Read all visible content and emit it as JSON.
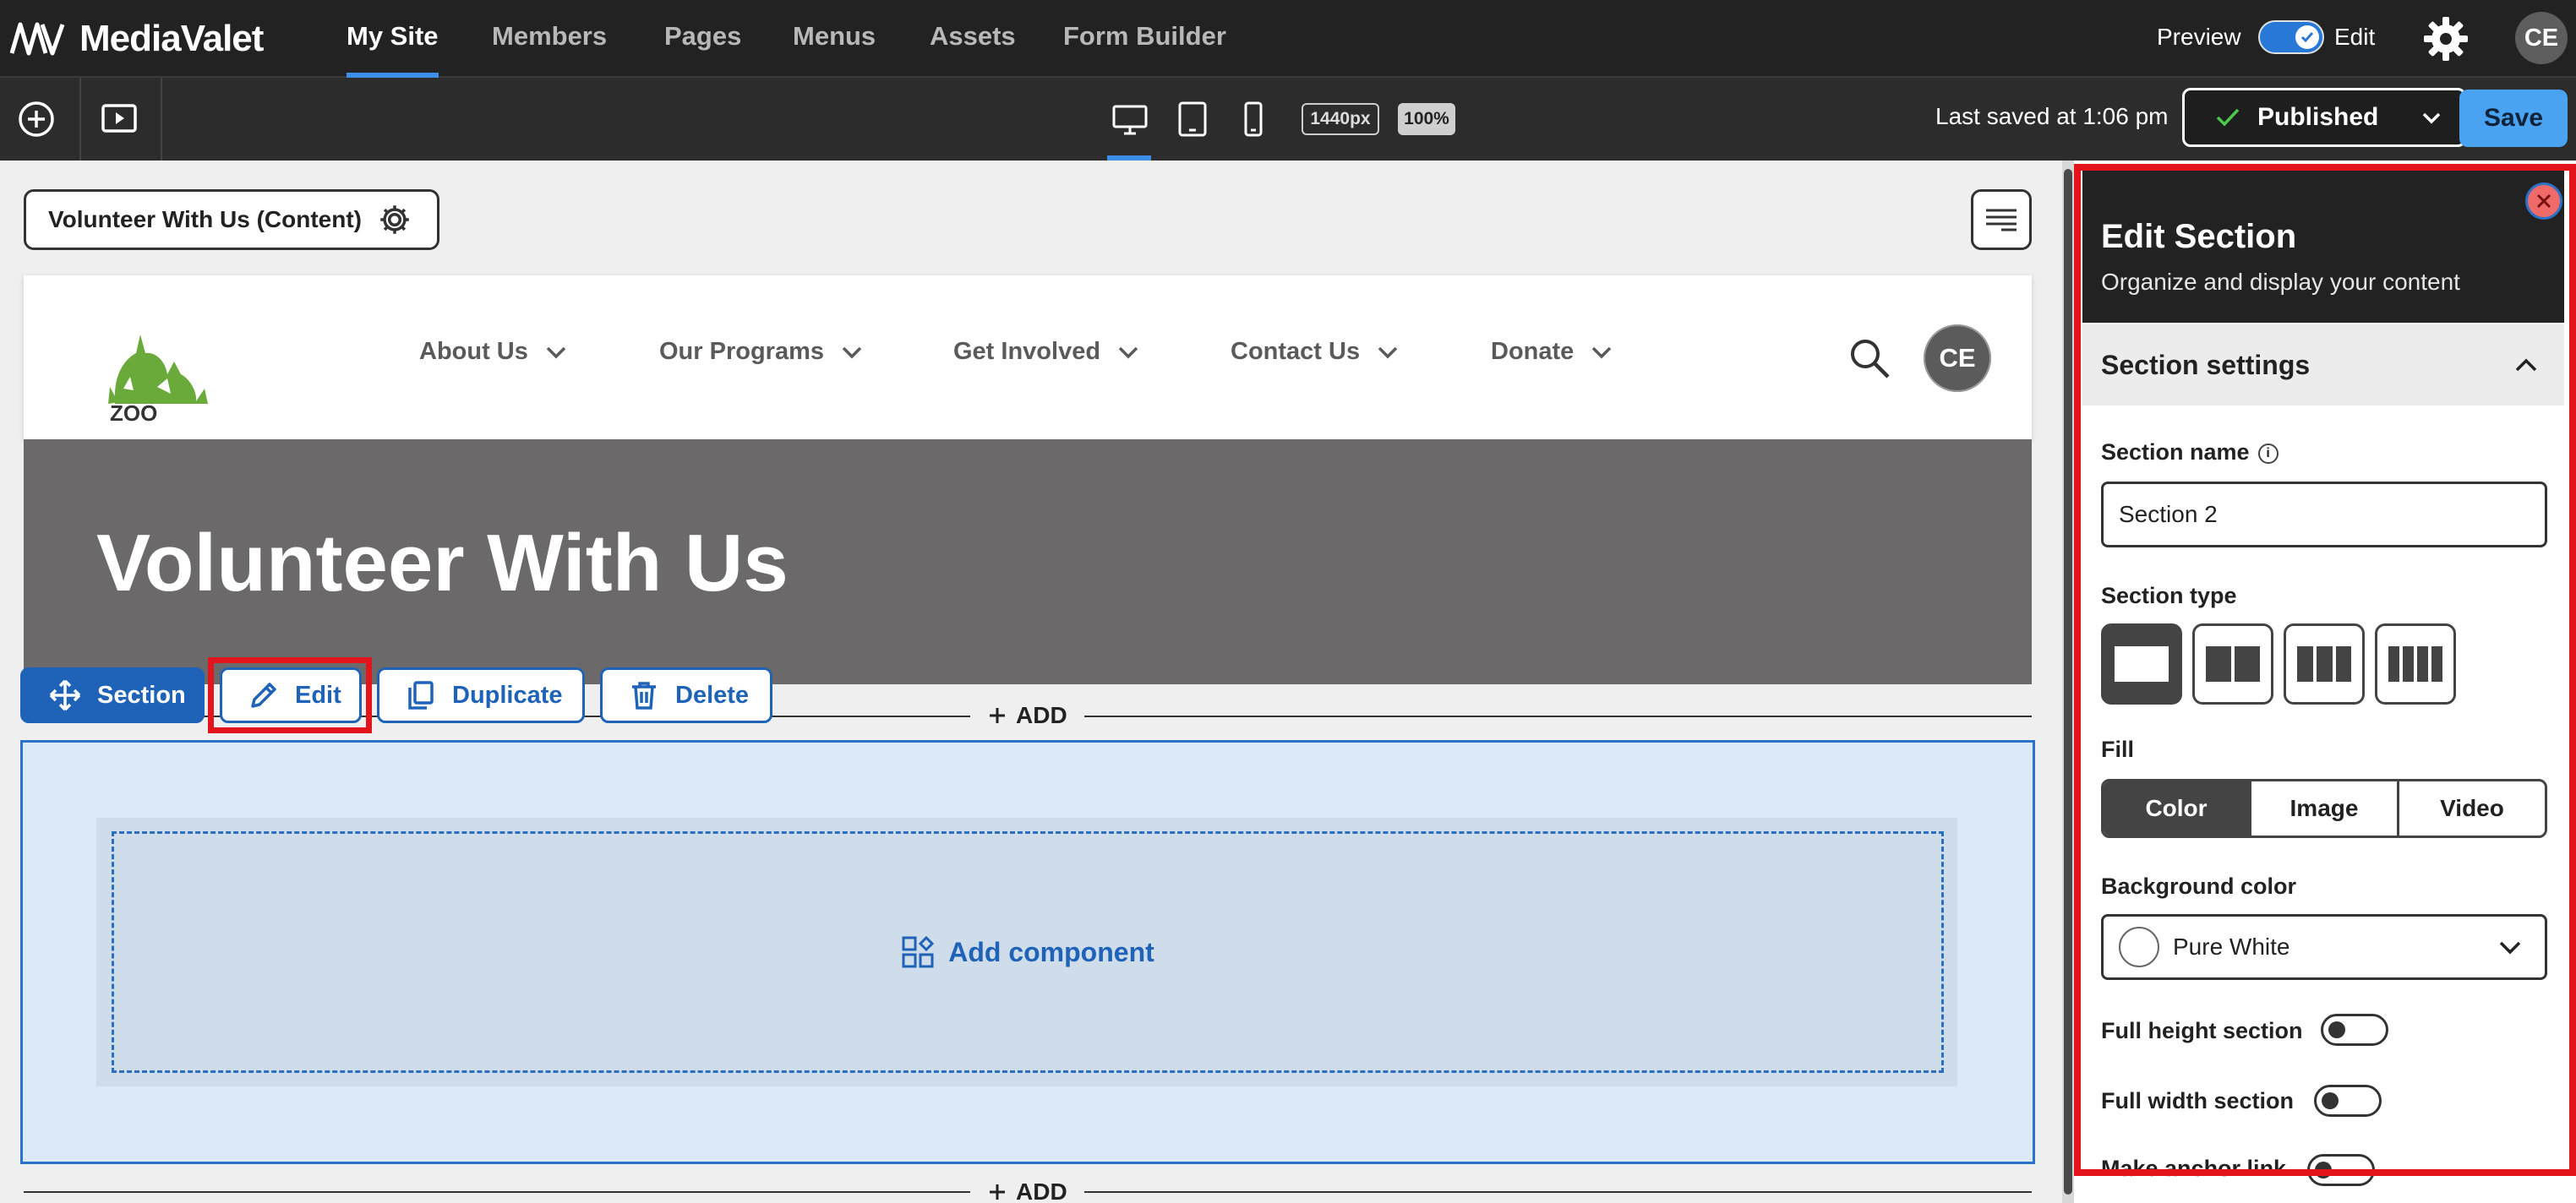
{
  "app": {
    "logo_text": "MediaValet",
    "nav": [
      {
        "label": "My Site",
        "active": true
      },
      {
        "label": "Members"
      },
      {
        "label": "Pages"
      },
      {
        "label": "Menus"
      },
      {
        "label": "Assets"
      },
      {
        "label": "Form Builder"
      }
    ],
    "preview_label": "Preview",
    "edit_label": "Edit",
    "avatar_initials": "CE"
  },
  "toolbar": {
    "width_label": "1440px",
    "zoom_label": "100%",
    "last_saved": "Last saved at 1:06 pm",
    "status_label": "Published",
    "save_label": "Save"
  },
  "canvas": {
    "page_name": "Volunteer With Us (Content)",
    "site": {
      "logo_text": "ZOO",
      "nav": [
        "About Us",
        "Our Programs",
        "Get Involved",
        "Contact Us",
        "Donate"
      ],
      "avatar_initials": "CE",
      "hero_title": "Volunteer With Us"
    },
    "section_controls": {
      "section": "Section",
      "edit": "Edit",
      "duplicate": "Duplicate",
      "delete": "Delete"
    },
    "add_label": "ADD",
    "add_component": "Add component"
  },
  "panel": {
    "title": "Edit Section",
    "subtitle": "Organize and display your content",
    "accordion_title": "Section settings",
    "section_name_label": "Section name",
    "section_name_value": "Section 2",
    "section_type_label": "Section type",
    "fill_label": "Fill",
    "fill_options": [
      "Color",
      "Image",
      "Video"
    ],
    "bg_color_label": "Background color",
    "bg_color_value": "Pure White",
    "full_height_label": "Full height section",
    "full_width_label": "Full width section",
    "anchor_label": "Make anchor link"
  },
  "colors": {
    "accent": "#1f63b8",
    "highlight": "#e4141c",
    "topbar": "#222222"
  }
}
